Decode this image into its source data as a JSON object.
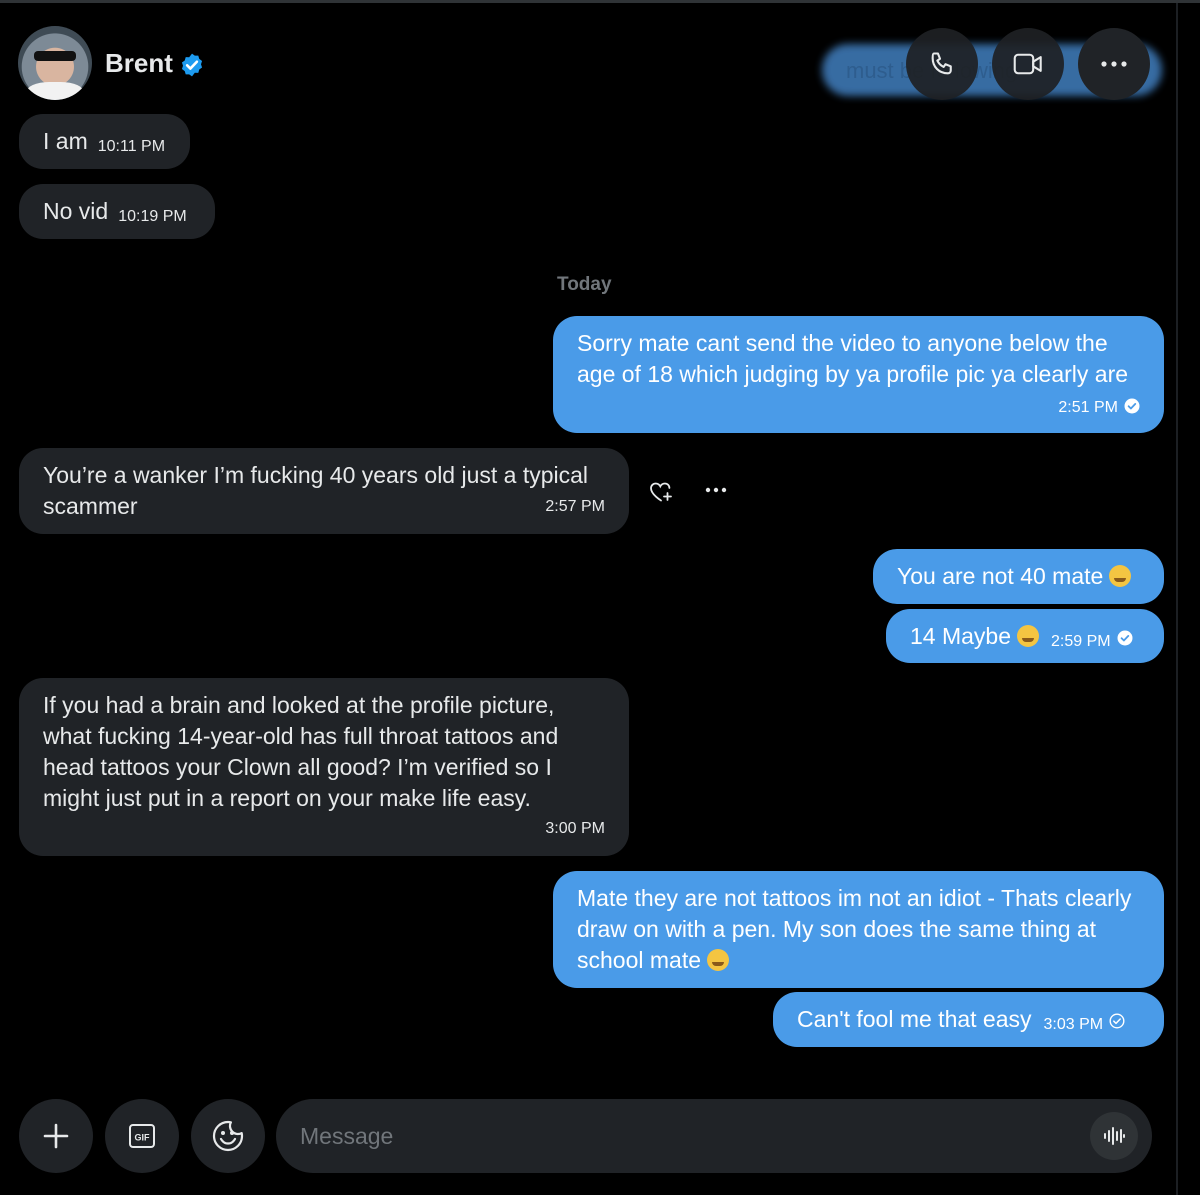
{
  "contact": {
    "name": "Brent",
    "verified": true,
    "blurred_text": "must be fo lowing"
  },
  "header_icons": [
    "phone-icon",
    "video-icon",
    "more-icon"
  ],
  "divider": {
    "label": "Today"
  },
  "messages": [
    {
      "direction": "in",
      "text": "I am",
      "time": "10:11 PM"
    },
    {
      "direction": "in",
      "text": "No vid",
      "time": "10:19 PM"
    },
    {
      "direction": "out",
      "text": "Sorry mate cant send the video to anyone below the age of 18 which judging by ya profile pic ya clearly are",
      "time": "2:51 PM"
    },
    {
      "direction": "in",
      "text": "You’re a wanker I’m fucking 40 years old just a typical scammer",
      "time": "2:57 PM"
    },
    {
      "direction": "out",
      "text": "You are not 40 mate",
      "emoji": "rofl-emoji"
    },
    {
      "direction": "out",
      "text": "14 Maybe",
      "emoji": "thinking-emoji",
      "time": "2:59 PM"
    },
    {
      "direction": "in",
      "text": "If you had a brain and looked at the profile picture, what fucking 14-year-old has full throat tattoos and head tattoos your Clown all good? I’m verified so I might just put in a report on your make life easy.",
      "time": "3:00 PM"
    },
    {
      "direction": "out",
      "text": "Mate they are not tattoos im not an idiot - Thats clearly draw on with a pen. My son does the same thing at school mate",
      "emoji": "rofl-emoji"
    },
    {
      "direction": "out",
      "text": "Can't fool me that easy",
      "time": "3:03 PM"
    }
  ],
  "composer": {
    "placeholder": "Message",
    "gif_label": "GIF"
  },
  "colors": {
    "outgoing": "#4a9be8",
    "incoming": "#202327",
    "background": "#000000",
    "verified": "#1d9bf0"
  }
}
